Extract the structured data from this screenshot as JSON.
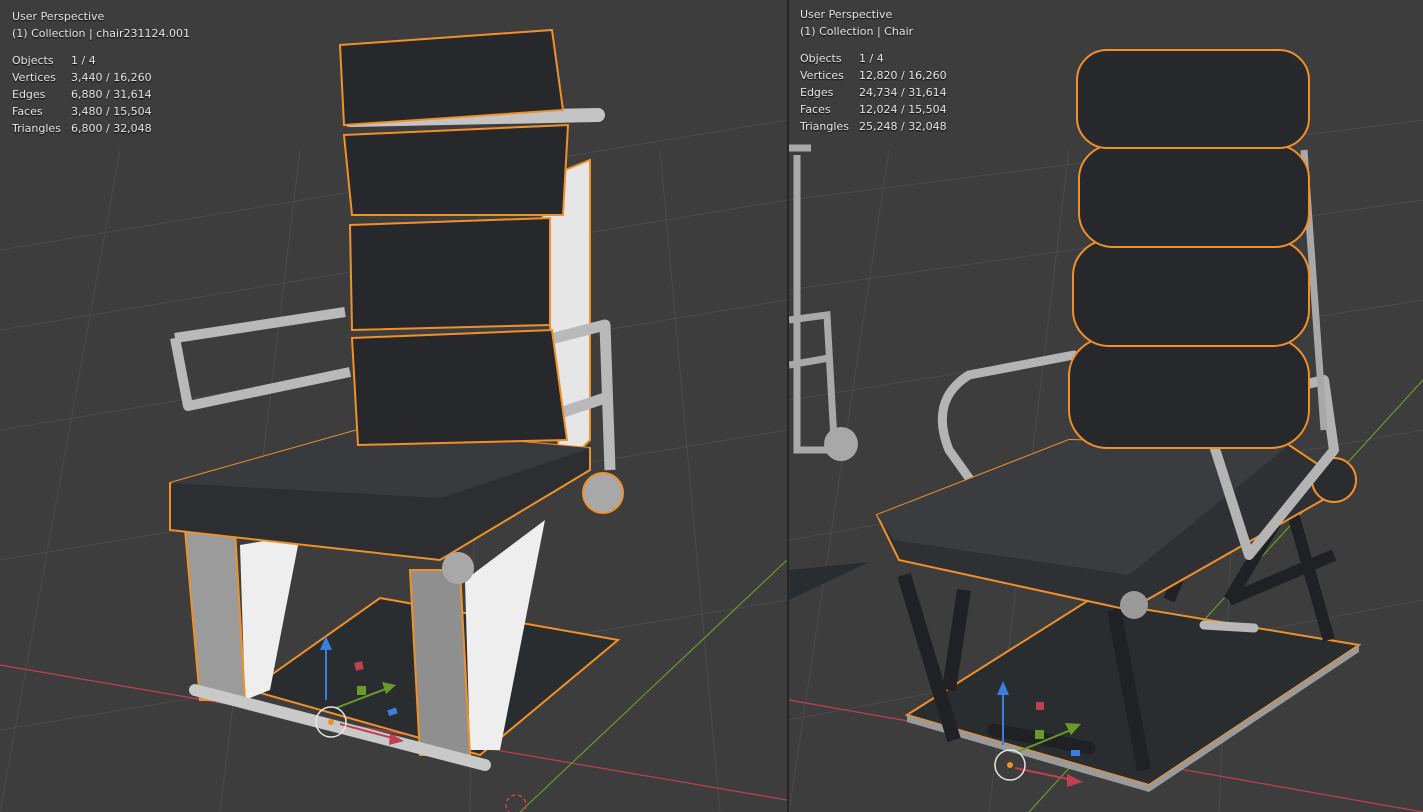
{
  "left_viewport": {
    "perspective": "User Perspective",
    "collection": "(1) Collection | chair231124.001",
    "stats": [
      {
        "label": "Objects",
        "value": "1 / 4"
      },
      {
        "label": "Vertices",
        "value": "3,440 / 16,260"
      },
      {
        "label": "Edges",
        "value": "6,880 / 31,614"
      },
      {
        "label": "Faces",
        "value": "3,480 / 15,504"
      },
      {
        "label": "Triangles",
        "value": "6,800 / 32,048"
      }
    ]
  },
  "right_viewport": {
    "perspective": "User Perspective",
    "collection": "(1) Collection | Chair",
    "stats": [
      {
        "label": "Objects",
        "value": "1 / 4"
      },
      {
        "label": "Vertices",
        "value": "12,820 / 16,260"
      },
      {
        "label": "Edges",
        "value": "24,734 / 31,614"
      },
      {
        "label": "Faces",
        "value": "12,024 / 15,504"
      },
      {
        "label": "Triangles",
        "value": "25,248 / 32,048"
      }
    ]
  },
  "colors": {
    "background": "#3d3d3d",
    "grid": "#4a4a4a",
    "selection_outline": "#f0902a",
    "x_axis": "#c0404f",
    "y_axis": "#6a9a2a",
    "z_axis": "#3a7fe0"
  }
}
